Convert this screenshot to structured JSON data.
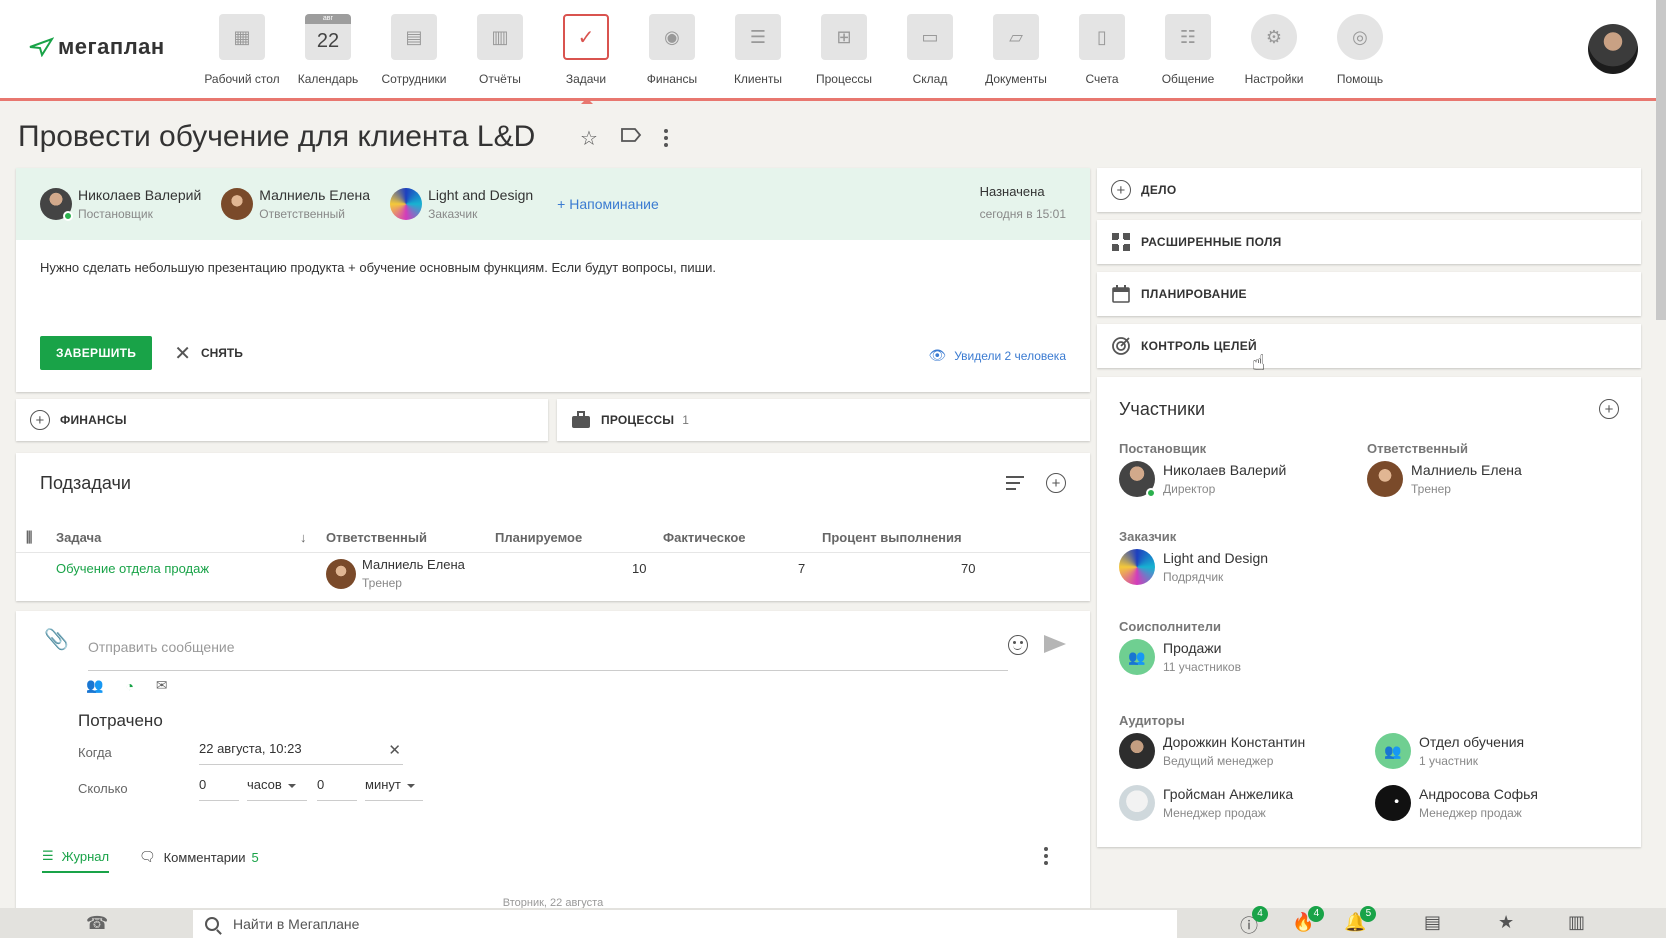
{
  "app": {
    "logo_text": "мегаплан"
  },
  "nav": [
    {
      "label": "Рабочий стол",
      "icon": "desktop-icon"
    },
    {
      "label": "Календарь",
      "icon": "calendar-icon",
      "cal_month": "авг",
      "cal_day": "22"
    },
    {
      "label": "Сотрудники",
      "icon": "employees-icon"
    },
    {
      "label": "Отчёты",
      "icon": "reports-icon"
    },
    {
      "label": "Задачи",
      "icon": "tasks-icon",
      "active": true
    },
    {
      "label": "Финансы",
      "icon": "safe-icon"
    },
    {
      "label": "Клиенты",
      "icon": "clients-icon"
    },
    {
      "label": "Процессы",
      "icon": "processes-icon"
    },
    {
      "label": "Склад",
      "icon": "warehouse-icon"
    },
    {
      "label": "Документы",
      "icon": "documents-icon"
    },
    {
      "label": "Счета",
      "icon": "invoices-icon"
    },
    {
      "label": "Общение",
      "icon": "chat-icon"
    },
    {
      "label": "Настройки",
      "icon": "settings-icon"
    },
    {
      "label": "Помощь",
      "icon": "help-icon"
    }
  ],
  "task": {
    "title": "Провести обучение для клиента L&D",
    "people": [
      {
        "name": "Николаев Валерий",
        "role": "Постановщик"
      },
      {
        "name": "Малниель Елена",
        "role": "Ответственный"
      },
      {
        "name": "Light and Design",
        "role": "Заказчик"
      }
    ],
    "reminder": "+ Напоминание",
    "status": "Назначена",
    "status_time": "сегодня в 15:01",
    "description": "Нужно сделать небольшую презентацию продукта + обучение основным функциям. Если будут вопросы, пиши.",
    "complete_label": "ЗАВЕРШИТЬ",
    "remove_label": "СНЯТЬ",
    "seen_label": "Увидели 2 человека"
  },
  "finance_label": "ФИНАНСЫ",
  "processes": {
    "label": "ПРОЦЕССЫ",
    "count": "1"
  },
  "subtasks": {
    "title": "Подзадачи",
    "headers": [
      "Задача",
      "Ответственный",
      "Планируемое",
      "Фактическое",
      "Процент выполнения"
    ],
    "rows": [
      {
        "task": "Обучение отдела продаж",
        "responsible": "Малниель Елена",
        "responsible_role": "Тренер",
        "planned": "10",
        "actual": "7",
        "percent": "70"
      }
    ]
  },
  "message": {
    "placeholder": "Отправить сообщение",
    "spent_title": "Потрачено",
    "when_label": "Когда",
    "when_value": "22 августа, 10:23",
    "howmuch_label": "Сколько",
    "hours_value": "0",
    "hours_unit": "часов",
    "minutes_value": "0",
    "minutes_unit": "минут"
  },
  "tabs": [
    {
      "label": "Журнал"
    },
    {
      "label": "Комментарии",
      "count": "5"
    }
  ],
  "date_separator": "Вторник, 22 августа",
  "side": {
    "buttons": [
      "ДЕЛО",
      "РАСШИРЕННЫЕ ПОЛЯ",
      "ПЛАНИРОВАНИЕ",
      "КОНТРОЛЬ ЦЕЛЕЙ"
    ],
    "participants_title": "Участники",
    "groups": {
      "creator_label": "Постановщик",
      "creator": {
        "name": "Николаев Валерий",
        "role": "Директор"
      },
      "responsible_label": "Ответственный",
      "responsible": {
        "name": "Малниель Елена",
        "role": "Тренер"
      },
      "customer_label": "Заказчик",
      "customer": {
        "name": "Light and Design",
        "role": "Подрядчик"
      },
      "coexec_label": "Соисполнители",
      "coexec": {
        "name": "Продажи",
        "role": "11 участников"
      },
      "auditors_label": "Аудиторы",
      "auditors": [
        {
          "name": "Дорожкин Константин",
          "role": "Ведущий менеджер"
        },
        {
          "name": "Отдел обучения",
          "role": "1 участник"
        },
        {
          "name": "Гройсман Анжелика",
          "role": "Менеджер продаж"
        },
        {
          "name": "Андросова Софья",
          "role": "Менеджер продаж"
        }
      ]
    }
  },
  "bottom": {
    "search_placeholder": "Найти в Мегаплане",
    "badges": [
      "4",
      "4",
      "5"
    ]
  },
  "colors": {
    "accent": "#19a348",
    "nav_underline": "#e8776f",
    "link": "#3b7bd1",
    "band": "#e6f4ec"
  }
}
